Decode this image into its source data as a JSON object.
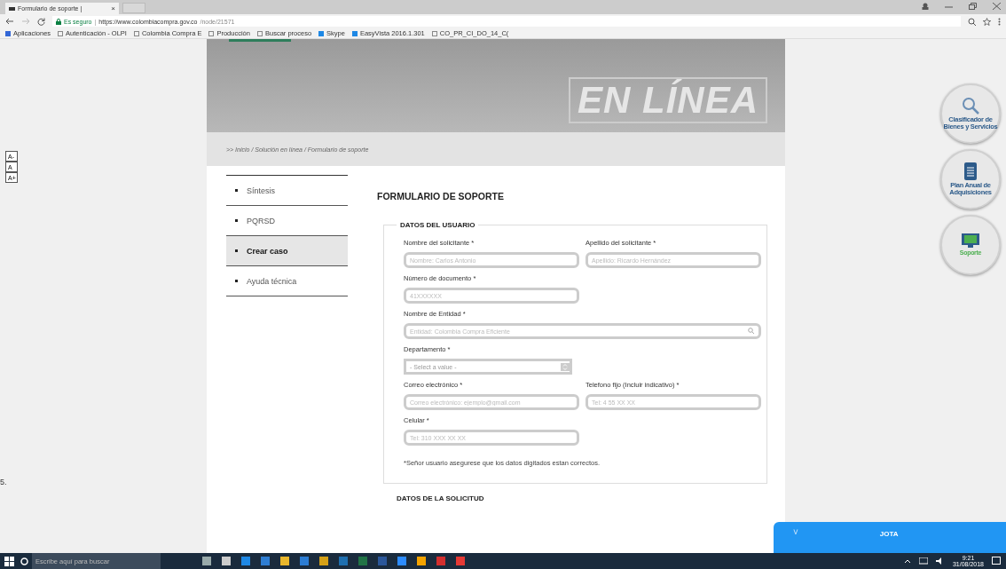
{
  "browser": {
    "tab_title": "Formulario de soporte | ",
    "tab_close": "×",
    "url_secure": "Es seguro",
    "url_sep": "|",
    "url_host": "https://www.colombiacompra.gov.co",
    "url_path": "/node/21571",
    "bookmarks": [
      "Aplicaciones",
      "Autenticación - OLPI",
      "Colombia Compra E",
      "Producción",
      "Buscar proceso",
      "Skype",
      "EasyVista 2016.1.301",
      "CO_PR_CI_DO_14_C("
    ]
  },
  "font_controls": [
    "A-",
    "A",
    "A+"
  ],
  "stray_text": "5.",
  "banner": {
    "title": "EN LÍNEA"
  },
  "breadcrumb": ">> Inicio / Solución en línea / Formulario de soporte",
  "menu": [
    {
      "label": "Síntesis",
      "selected": false
    },
    {
      "label": "PQRSD",
      "selected": false
    },
    {
      "label": "Crear caso",
      "selected": true
    },
    {
      "label": "Ayuda técnica",
      "selected": false
    }
  ],
  "form": {
    "title": "FORMULARIO DE SOPORTE",
    "section": "DATOS DEL USUARIO",
    "rows": [
      [
        {
          "kind": "text",
          "label": "Nombre del solicitante *",
          "placeholder": "Nombre: Carlos Antonio"
        },
        {
          "kind": "text",
          "label": "Apellido del solicitante *",
          "placeholder": "Apellido: Ricardo Hernández"
        }
      ],
      [
        {
          "kind": "text",
          "label": "Número de documento *",
          "placeholder": "41XXXXXX"
        }
      ],
      [
        {
          "kind": "autocomplete",
          "label": "Nombre de Entidad *",
          "placeholder": "Entidad: Colombia Compra Eficiente"
        }
      ],
      [
        {
          "kind": "select",
          "label": "Departamento *",
          "placeholder": "- Select a value -"
        }
      ],
      [
        {
          "kind": "text",
          "label": "Correo electrónico *",
          "placeholder": "Correo electrónico: ejemplo@gmail.com"
        },
        {
          "kind": "text",
          "label": "Telefono fijo (Incluir indicativo) *",
          "placeholder": "Tel: 4 55 XX XX"
        }
      ],
      [
        {
          "kind": "text",
          "label": "Celular *",
          "placeholder": "Tel: 310 XXX XX XX"
        }
      ]
    ],
    "note": "*Señor usuario asegurese que los datos digitados estan correctos.",
    "next_section": "DATOS DE LA SOLICITUD"
  },
  "side_buttons": [
    {
      "kind": "search",
      "label": "Clasificador de Bienes y Servicios"
    },
    {
      "kind": "document",
      "label": "Plan Anual de Adquisiciones"
    },
    {
      "kind": "support",
      "label": "Soporte"
    }
  ],
  "chat": {
    "title": "JOTA",
    "toggle": "˅"
  },
  "taskbar": {
    "search_placeholder": "Escribe aquí para buscar",
    "time": "9:21",
    "date": "31/08/2018"
  }
}
